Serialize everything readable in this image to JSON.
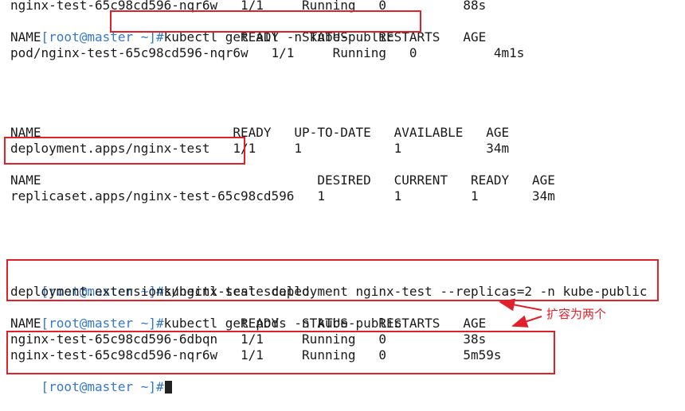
{
  "prompt": "[root@master ~]#",
  "lines": [
    {
      "type": "text",
      "text": "nginx-test-65c98cd596-nqr6w   1/1     Running   0          88s"
    },
    {
      "type": "cmd",
      "cmd": "kubectl get all -n kube-public"
    },
    {
      "type": "text",
      "text": "NAME                          READY   STATUS    RESTARTS   AGE"
    },
    {
      "type": "text",
      "text": "pod/nginx-test-65c98cd596-nqr6w   1/1     Running   0          4m1s"
    },
    {
      "type": "text",
      "text": "NAME                         READY   UP-TO-DATE   AVAILABLE   AGE"
    },
    {
      "type": "text",
      "text": "deployment.apps/nginx-test   1/1     1            1           34m"
    },
    {
      "type": "text",
      "text": "NAME                                    DESIRED   CURRENT   READY   AGE"
    },
    {
      "type": "text",
      "text": "replicaset.apps/nginx-test-65c98cd596   1         1         1       34m"
    },
    {
      "type": "cmd",
      "cmd": "kubectl scale deployment nginx-test --replicas=2 -n kube-public"
    },
    {
      "type": "text",
      "text": "deployment.extensions/nginx-test scaled"
    },
    {
      "type": "cmd",
      "cmd": "kubectl get pods -n kube-public"
    },
    {
      "type": "text",
      "text": "NAME                          READY   STATUS    RESTARTS   AGE"
    },
    {
      "type": "text",
      "text": "nginx-test-65c98cd596-6dbqn   1/1     Running   0          38s"
    },
    {
      "type": "text",
      "text": "nginx-test-65c98cd596-nqr6w   1/1     Running   0          5m59s"
    },
    {
      "type": "prompt_only",
      "cmd": ""
    }
  ],
  "annotation": "扩容为两个",
  "colors": {
    "prompt": "#3478c8",
    "highlight": "#e0202a",
    "text": "#1a1a1a",
    "background": "#ffffff"
  }
}
